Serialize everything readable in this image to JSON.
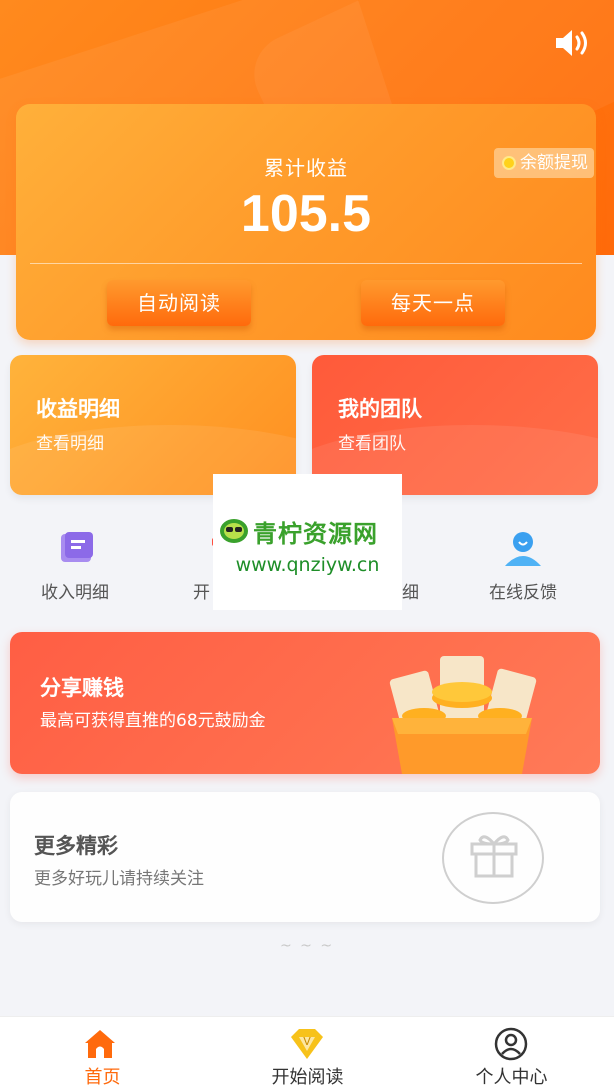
{
  "header": {
    "speaker_icon": "speaker-icon"
  },
  "earnings": {
    "title": "累计收益",
    "amount": "105.5",
    "withdraw_label": "余额提现",
    "btn_auto_read": "自动阅读",
    "btn_daily": "每天一点"
  },
  "tiles": [
    {
      "title": "收益明细",
      "subtitle": "查看明细"
    },
    {
      "title": "我的团队",
      "subtitle": "查看团队"
    }
  ],
  "quick_links": [
    {
      "label": "收入明细",
      "icon": "document-icon"
    },
    {
      "label": "开",
      "icon": "gift-box-icon"
    },
    {
      "label": "细",
      "icon": "list-icon"
    },
    {
      "label": "在线反馈",
      "icon": "user-support-icon"
    }
  ],
  "watermark": {
    "title": "青柠资源网",
    "url": "www.qnziyw.cn"
  },
  "share": {
    "title": "分享赚钱",
    "subtitle": "最高可获得直推的68元鼓励金"
  },
  "more": {
    "title": "更多精彩",
    "subtitle": "更多好玩儿请持续关注"
  },
  "divider_dots": "~ ~ ~",
  "tabbar": [
    {
      "label": "首页",
      "icon": "home-icon",
      "active": true
    },
    {
      "label": "开始阅读",
      "icon": "diamond-icon",
      "active": false
    },
    {
      "label": "个人中心",
      "icon": "user-icon",
      "active": false
    }
  ],
  "colors": {
    "accent": "#ff6a0c",
    "hero": "#ff7a12",
    "share": "#ff5e44"
  }
}
